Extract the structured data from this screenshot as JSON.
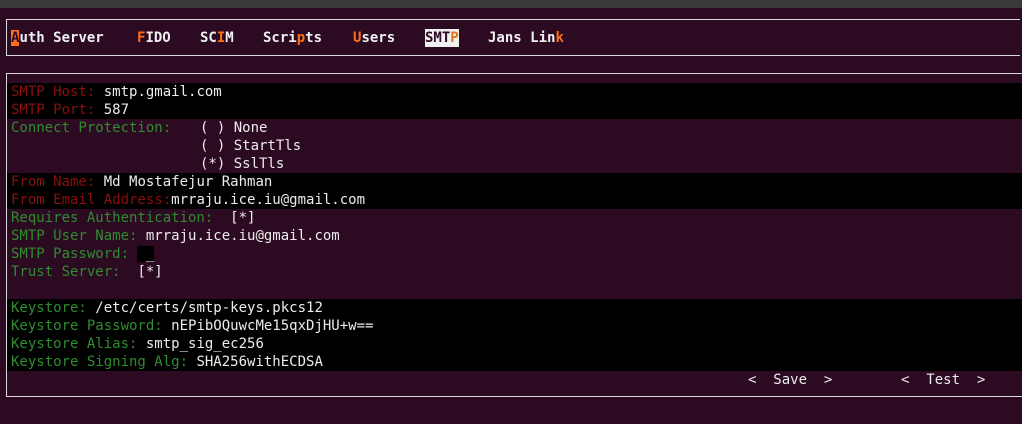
{
  "nav": {
    "tabs": [
      {
        "hot": "A",
        "rest": "uth Server",
        "active": false
      },
      {
        "hot": "F",
        "rest": "IDO",
        "active": false
      },
      {
        "pre": "SC",
        "hot": "I",
        "rest": "M",
        "active": false
      },
      {
        "pre": "Scri",
        "hot": "p",
        "rest": "ts",
        "active": false
      },
      {
        "hot": "U",
        "rest": "sers",
        "active": false
      },
      {
        "pre": "SMT",
        "hot": "P",
        "rest": "",
        "active": true
      },
      {
        "pre": "Jans Lin",
        "hot": "k",
        "rest": "",
        "active": false
      }
    ]
  },
  "form": {
    "smtp_host_label": "SMTP Host:",
    "smtp_host_value": "smtp.gmail.com",
    "smtp_port_label": "SMTP Port:",
    "smtp_port_value": "587",
    "connect_protection_label": "Connect Protection:",
    "radio_none": "( ) None",
    "radio_starttls": "( ) StartTls",
    "radio_ssltls": "(*) SslTls",
    "from_name_label": "From Name:",
    "from_name_value": "Md Mostafejur Rahman",
    "from_email_label": "From Email Address:",
    "from_email_value": "mrraju.ice.iu@gmail.com",
    "requires_auth_label": "Requires Authentication:",
    "requires_auth_value": "[*]",
    "smtp_user_label": "SMTP User Name:",
    "smtp_user_value": "mrraju.ice.iu@gmail.com",
    "smtp_password_label": "SMTP Password:",
    "smtp_password_value": "_",
    "trust_server_label": "Trust Server:",
    "trust_server_value": "[*]",
    "keystore_label": "Keystore:",
    "keystore_value": "/etc/certs/smtp-keys.pkcs12",
    "keystore_password_label": "Keystore Password:",
    "keystore_password_value": "nEPibOQuwcMe15qxDjHU+w==",
    "keystore_alias_label": "Keystore Alias:",
    "keystore_alias_value": "smtp_sig_ec256",
    "keystore_alg_label": "Keystore Signing Alg:",
    "keystore_alg_value": "SHA256withECDSA"
  },
  "buttons": {
    "save": "<  Save  >",
    "test": "<  Test  >"
  },
  "colors": {
    "background": "#2c0a22",
    "hotkey": "#ff6e1a",
    "label_red": "#8a0f0f",
    "label_green": "#2f8c2f"
  }
}
